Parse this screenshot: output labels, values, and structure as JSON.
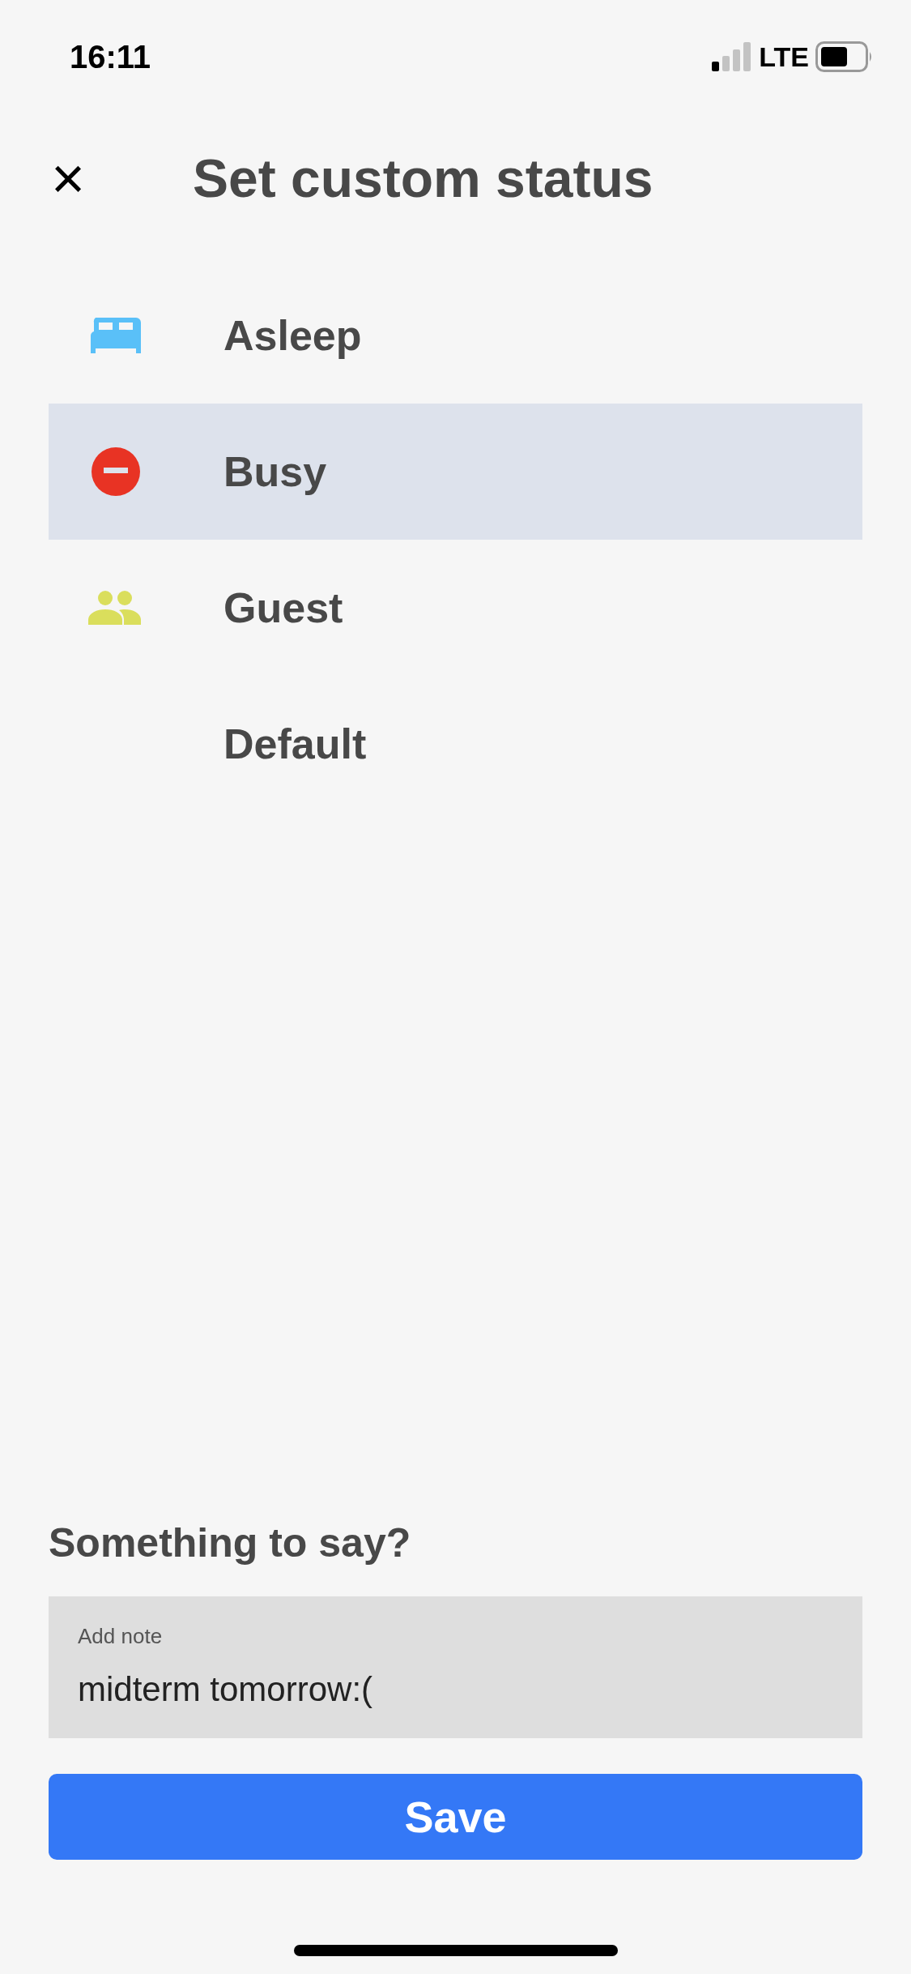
{
  "status_bar": {
    "time": "16:11",
    "network": "LTE"
  },
  "header": {
    "close_icon": "×",
    "title": "Set custom status"
  },
  "statuses": [
    {
      "kind": "bed",
      "label": "Asleep",
      "color": "#5ac0f8",
      "selected": false
    },
    {
      "kind": "busy",
      "label": "Busy",
      "color": "#e83324",
      "selected": true
    },
    {
      "kind": "people",
      "label": "Guest",
      "color": "#dade5c",
      "selected": false
    },
    {
      "kind": "none",
      "label": "Default",
      "selected": false
    }
  ],
  "note": {
    "heading": "Something to say?",
    "placeholder": "Add note",
    "value": "midterm tomorrow:("
  },
  "save_button": "Save"
}
